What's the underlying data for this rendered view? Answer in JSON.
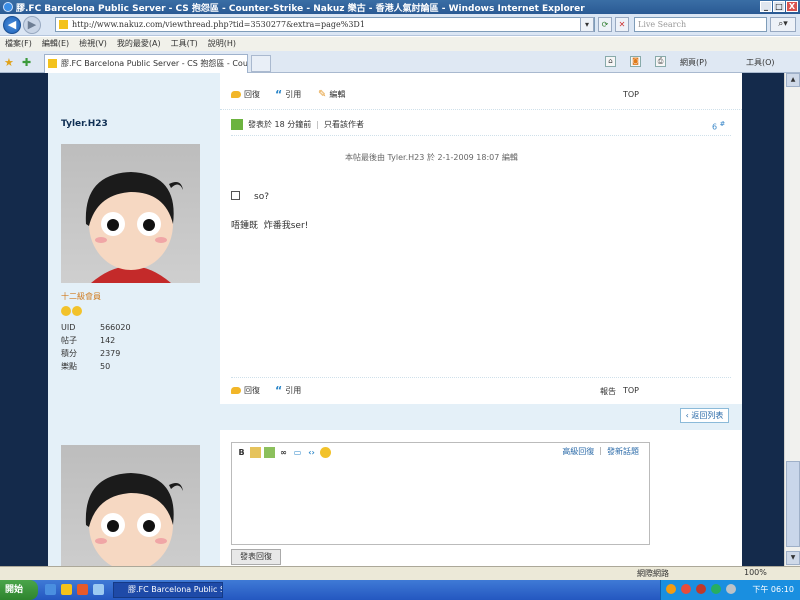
{
  "window": {
    "title": "膠.FC Barcelona Public Server - CS 抱怨區 - Counter-Strike - Nakuz 樂古 - 香港人氣討論區 - Windows Internet Explorer",
    "buttons": [
      "_",
      "□",
      "X"
    ]
  },
  "address": {
    "url": "http://www.nakuz.com/viewthread.php?tid=3530277&extra=page%3D1",
    "search_placeholder": "Live Search"
  },
  "menu": [
    "檔案(F)",
    "編輯(E)",
    "檢視(V)",
    "我的最愛(A)",
    "工具(T)",
    "說明(H)"
  ],
  "tab": {
    "label": "膠.FC Barcelona Public Server - CS 抱怨區 - Counter-...",
    "commands": {
      "page": "網頁(P)",
      "tools": "工具(O)"
    }
  },
  "post_actions": {
    "reply": "回復",
    "quote": "引用",
    "edit": "編輯",
    "report": "報告",
    "top": "TOP"
  },
  "post": {
    "username": "Tyler.H23",
    "rank": "十二級會員",
    "posted": "發表於 18 分鐘前",
    "author_only": "只看該作者",
    "floor": "6",
    "floor_sup": "#",
    "edit_note": "本帖最後由 Tyler.H23 於 2-1-2009 18:07 編輯",
    "line1": "so?",
    "line2": "唔鍾既  炸番我ser!",
    "stats": [
      {
        "k": "UID",
        "v": "566020"
      },
      {
        "k": "帖子",
        "v": "142"
      },
      {
        "k": "積分",
        "v": "2379"
      },
      {
        "k": "樂點",
        "v": "50"
      }
    ]
  },
  "back_to_list": "‹ 返回列表",
  "editor": {
    "toolbar": [
      "B"
    ],
    "advanced_reply": "高級回復",
    "new_topic": "發新話題",
    "sep": "|",
    "submit": "發表回復"
  },
  "statusbar": {
    "zone": "網際網路",
    "zoom": "100%"
  },
  "taskbar": {
    "start": "開始",
    "task": "膠.FC Barcelona Public S...",
    "clock": "下午 06:10"
  },
  "colors": {
    "page_bg": "#142a4b",
    "accent": "#2a86c8",
    "userbar": "#e4f0f8"
  }
}
